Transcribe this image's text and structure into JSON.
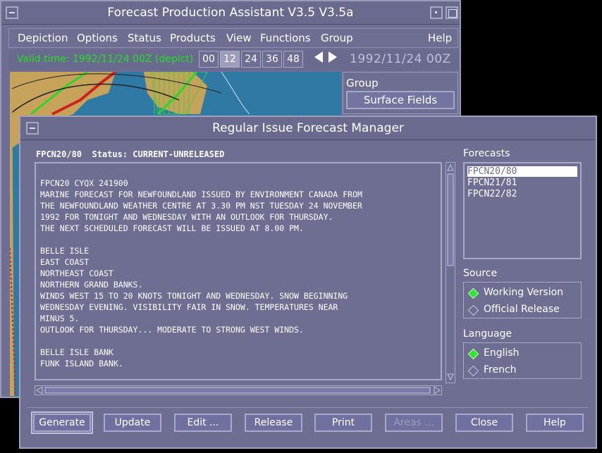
{
  "back_window": {
    "title": "Forecast Production Assistant V3.5 V3.5a",
    "menu": [
      "Depiction",
      "Options",
      "Status",
      "Products",
      "View",
      "Functions",
      "Group",
      "Help"
    ],
    "valid_time": "Valid time: 1992/11/24 00Z (depict)",
    "hours": [
      "00",
      "12",
      "24",
      "36",
      "48"
    ],
    "selected_hour": "12",
    "date_readout": "1992/11/24 00Z",
    "group_label": "Group",
    "surface_fields": "Surface Fields"
  },
  "front_window": {
    "title": "Regular Issue Forecast Manager",
    "header": "FPCN20/80  Status: CURRENT-UNRELEASED",
    "forecast_text": [
      "FPCN20 CYQX 241900",
      "MARINE FORECAST FOR NEWFOUNDLAND ISSUED BY ENVIRONMENT CANADA FROM",
      "THE NEWFOUNDLAND WEATHER CENTRE AT 3.30 PM NST TUESDAY 24 NOVEMBER",
      "1992 FOR TONIGHT AND WEDNESDAY WITH AN OUTLOOK FOR THURSDAY.",
      "THE NEXT SCHEDULED FORECAST WILL BE ISSUED AT 8.00 PM.",
      "",
      "BELLE ISLE",
      "EAST COAST",
      "NORTHEAST COAST",
      "NORTHERN GRAND BANKS.",
      "WINDS WEST 15 TO 20 KNOTS TONIGHT AND WEDNESDAY. SNOW BEGINNING",
      "WEDNESDAY EVENING. VISIBILITY FAIR IN SNOW. TEMPERATURES NEAR",
      "MINUS 5.",
      "OUTLOOK FOR THURSDAY... MODERATE TO STRONG WEST WINDS.",
      "",
      "BELLE ISLE BANK",
      "FUNK ISLAND BANK."
    ],
    "forecasts_label": "Forecasts",
    "forecasts": [
      "FPCN20/80",
      "FPCN21/81",
      "FPCN22/82"
    ],
    "selected_forecast": "FPCN20/80",
    "source_label": "Source",
    "source_options": [
      "Working Version",
      "Official Release"
    ],
    "source_selected": "Working Version",
    "language_label": "Language",
    "language_options": [
      "English",
      "French"
    ],
    "language_selected": "English",
    "buttons": [
      "Generate",
      "Update",
      "Edit ...",
      "Release",
      "Print",
      "Areas ...",
      "Close",
      "Help"
    ],
    "disabled_buttons": [
      "Areas ..."
    ],
    "default_button": "Generate"
  },
  "colors": {
    "panel": "#6e6e92",
    "valid_time_text": "#22e022",
    "radio_on": "#2ee62e",
    "map_water": "#2f7aa5",
    "map_land": "#c6a25a"
  }
}
